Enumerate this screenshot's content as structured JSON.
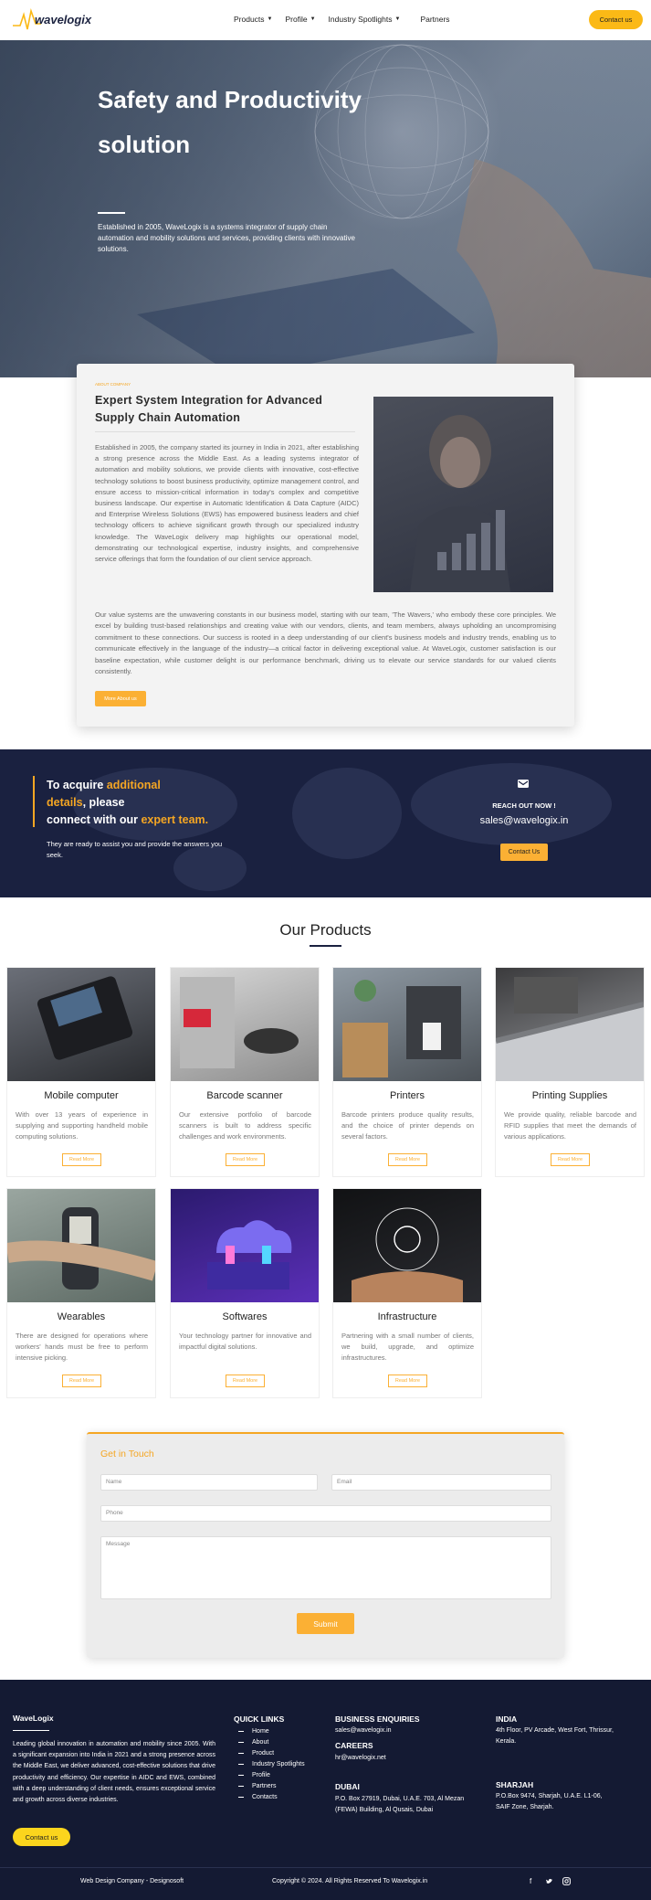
{
  "header": {
    "logo_text": "wavelogix",
    "nav": [
      {
        "label": "Products",
        "has_dropdown": true
      },
      {
        "label": "Profile",
        "has_dropdown": true
      },
      {
        "label": "Industry Spotlights",
        "has_dropdown": true
      },
      {
        "label": "Partners",
        "has_dropdown": false
      }
    ],
    "cta_label": "Contact us",
    "accent": "#fbb916"
  },
  "hero": {
    "title": "Safety and Productivity solution",
    "subtitle": "Established in 2005, WaveLogix is a systems integrator of supply chain automation and mobility solutions and services, providing clients with innovative solutions."
  },
  "about": {
    "tag": "ABOUT COMPANY",
    "title": "Expert System Integration for Advanced Supply Chain Automation",
    "paragraph1": "Established in 2005, the company started its journey in India in 2021, after establishing a strong presence across the Middle East. As a leading systems integrator of automation and mobility solutions, we provide clients with innovative, cost-effective technology solutions to boost business productivity, optimize management control, and ensure access to mission-critical information in today's complex and competitive business landscape. Our expertise in Automatic Identification & Data Capture (AIDC) and Enterprise Wireless Solutions (EWS) has empowered business leaders and chief technology officers to achieve significant growth through our specialized industry knowledge. The WaveLogix delivery map highlights our operational model, demonstrating our technological expertise, industry insights, and comprehensive service offerings that form the foundation of our client service approach.",
    "paragraph2": "Our value systems are the unwavering constants in our business model, starting with our team, 'The Wavers,' who embody these core principles. We excel by building trust-based relationships and creating value with our vendors, clients, and team members, always upholding an uncompromising commitment to these connections. Our success is rooted in a deep understanding of our client's business models and industry trends, enabling us to communicate effectively in the language of the industry—a critical factor in delivering exceptional value. At WaveLogix, customer satisfaction is our baseline expectation, while customer delight is our performance benchmark, driving us to elevate our service standards for our valued clients consistently.",
    "button": "More About us"
  },
  "cta": {
    "line1a": "To acquire ",
    "line1b": "additional",
    "line2a": "details",
    "line2b": ", please",
    "line3a": "connect with our ",
    "line3b": "expert team.",
    "sub": "They are ready to assist you and provide the answers you seek.",
    "reach": "REACH OUT NOW !",
    "email": "sales@wavelogix.in",
    "button": "Contact Us"
  },
  "products": {
    "title": "Our Products",
    "items": [
      {
        "title": "Mobile computer",
        "desc": "With over 13 years of experience in supplying and supporting handheld mobile computing solutions.",
        "button": "Read More"
      },
      {
        "title": "Barcode scanner",
        "desc": "Our extensive portfolio of barcode scanners is built to address specific challenges and work environments.",
        "button": "Read More"
      },
      {
        "title": "Printers",
        "desc": "Barcode printers produce quality results, and the choice of printer depends on several factors.",
        "button": "Read More"
      },
      {
        "title": "Printing Supplies",
        "desc": "We provide quality, reliable barcode and RFID supplies that meet the demands of various applications.",
        "button": "Read More"
      },
      {
        "title": "Wearables",
        "desc": "There are designed for operations where workers' hands must be free to perform intensive picking.",
        "button": "Read More"
      },
      {
        "title": "Softwares",
        "desc": "Your technology partner for innovative and impactful digital solutions.",
        "button": "Read More"
      },
      {
        "title": "Infrastructure",
        "desc": "Partnering with a small number of clients, we build, upgrade, and optimize infrastructures.",
        "button": "Read More"
      }
    ]
  },
  "contact_form": {
    "title": "Get in Touch",
    "name_placeholder": "Name",
    "email_placeholder": "Email",
    "phone_placeholder": "Phone",
    "message_placeholder": "Message",
    "submit": "Submit"
  },
  "footer": {
    "brand": "WaveLogix",
    "about": "Leading global innovation in automation and mobility since 2005. With a significant expansion into India in 2021 and a strong presence across the Middle East, we deliver advanced, cost-effective solutions that drive productivity and efficiency. Our expertise in AIDC and EWS, combined with a deep understanding of client needs, ensures exceptional service and growth across diverse industries.",
    "button": "Contact us",
    "quick_links_title": "QUICK LINKS",
    "quick_links": [
      "Home",
      "About",
      "Product",
      "Industry Spotlights",
      "Profile",
      "Partners",
      "Contacts"
    ],
    "business_title": "BUSINESS ENQUIRIES",
    "business_email": "sales@wavelogix.in",
    "careers_title": "CAREERS",
    "careers_email": "hr@wavelogix.net",
    "dubai_title": "DUBAI",
    "dubai_address": "P.O. Box 27919, Dubai, U.A.E. 703, Al Mezan (FEWA) Building, Al Qusais, Dubai",
    "india_title": "INDIA",
    "india_address": "4th Floor, PV Arcade, West Fort, Thrissur, Kerala.",
    "sharjah_title": "SHARJAH",
    "sharjah_address": "P.O.Box 9474, Sharjah, U.A.E. L1-06, SAIF Zone, Sharjah.",
    "bottom_left": "Web Design Company - Designosoft",
    "bottom_center": "Copyright © 2024. All Rights Reserved To Wavelogix.in",
    "social": [
      "facebook-icon",
      "twitter-icon",
      "instagram-icon"
    ]
  }
}
